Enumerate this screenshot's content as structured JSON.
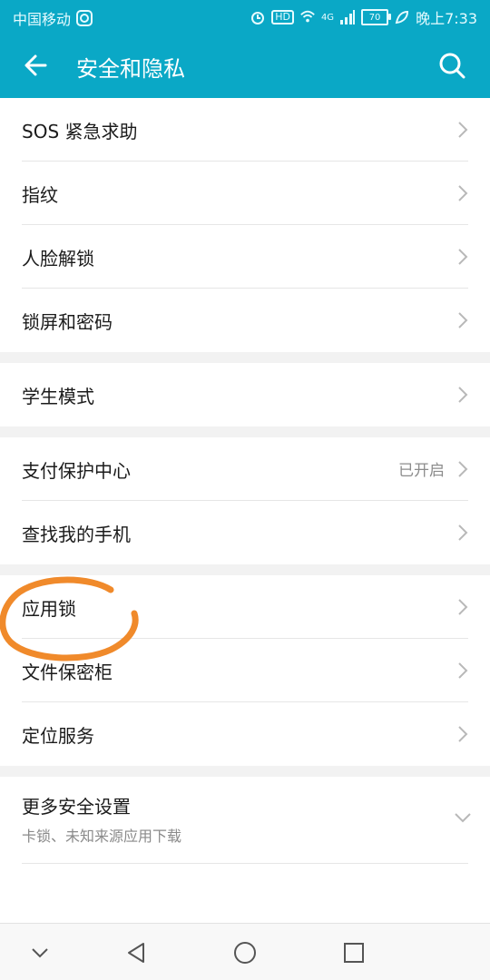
{
  "status_bar": {
    "carrier": "中国移动",
    "network": "4G",
    "battery": "70",
    "time": "晚上7:33"
  },
  "appbar": {
    "title": "安全和隐私"
  },
  "groups": [
    [
      "SOS 紧急求助",
      "指纹",
      "人脸解锁",
      "锁屏和密码"
    ],
    [
      "学生模式"
    ],
    [
      "支付保护中心",
      "查找我的手机"
    ],
    [
      "应用锁",
      "文件保密柜",
      "定位服务"
    ]
  ],
  "payment_status": "已开启",
  "more": {
    "title": "更多安全设置",
    "subtitle": "卡锁、未知来源应用下载"
  },
  "colors": {
    "accent": "#0aa8c6",
    "annotation": "#f08a2b"
  }
}
